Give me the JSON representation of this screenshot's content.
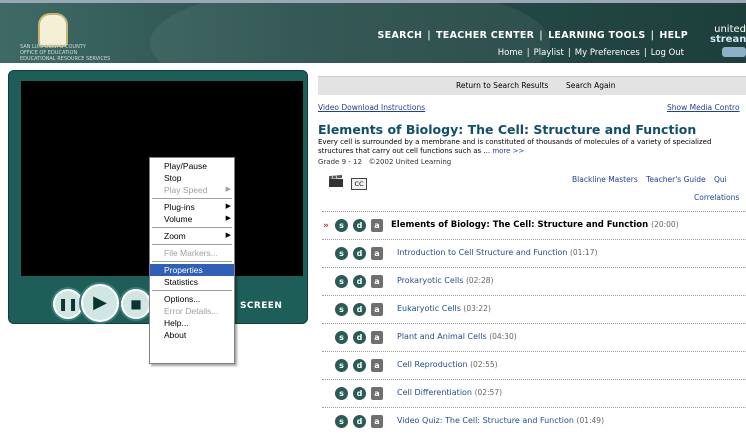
{
  "header": {
    "logo_lines": [
      "SAN LUIS OBISPO COUNTY",
      "OFFICE OF EDUCATION",
      "EDUCATIONAL RESOURCE SERVICES"
    ],
    "nav_main": [
      "SEARCH",
      "TEACHER CENTER",
      "LEARNING TOOLS",
      "HELP"
    ],
    "nav_sub": [
      "Home",
      "Playlist",
      "My Preferences",
      "Log Out"
    ],
    "brand": [
      "united",
      "strean"
    ]
  },
  "player": {
    "pause_icon": "pause-icon",
    "play_icon": "play-icon",
    "stop_icon": "stop-icon",
    "fullscreen_label": "SCREEN"
  },
  "context_menu": {
    "items": [
      {
        "label": "Play/Pause",
        "enabled": true,
        "submenu": false
      },
      {
        "label": "Stop",
        "enabled": true,
        "submenu": false
      },
      {
        "label": "Play Speed",
        "enabled": false,
        "submenu": true
      },
      {
        "label": "Plug-ins",
        "enabled": true,
        "submenu": true
      },
      {
        "label": "Volume",
        "enabled": true,
        "submenu": true
      },
      {
        "label": "Zoom",
        "enabled": true,
        "submenu": true
      },
      {
        "label": "File Markers...",
        "enabled": false,
        "submenu": false
      },
      {
        "label": "Properties",
        "enabled": true,
        "submenu": false,
        "selected": true
      },
      {
        "label": "Statistics",
        "enabled": true,
        "submenu": false
      },
      {
        "label": "Options...",
        "enabled": true,
        "submenu": false
      },
      {
        "label": "Error Details...",
        "enabled": false,
        "submenu": false
      },
      {
        "label": "Help...",
        "enabled": true,
        "submenu": false
      },
      {
        "label": "About",
        "enabled": true,
        "submenu": false
      }
    ]
  },
  "main": {
    "return_label": "Return to Search Results",
    "search_again_label": "Search Again",
    "download_link": "Video Download Instructions",
    "media_controls_link": "Show Media Contro",
    "title": "Elements of Biology: The Cell: Structure and Function",
    "description": "Every cell is surrounded by a membrane and is constituted of thousands of molecules of a variety of specialized structures that carry out cell functions such as ...",
    "more_link": "more >>",
    "grade": "Grade 9 - 12",
    "copyright": "©2002 United Learning",
    "cc_label": "CC",
    "resources": [
      "Blackline Masters",
      "Teacher's Guide",
      "Qui"
    ],
    "correlations_link": "Correlations",
    "current_marker": "»",
    "badge_labels": {
      "s": "s",
      "d": "d",
      "a": "a"
    },
    "segments": [
      {
        "title": "Elements of Biology: The Cell: Structure and Function",
        "duration": "(20:00)"
      },
      {
        "title": "Introduction to Cell Structure and Function",
        "duration": "(01:17)"
      },
      {
        "title": "Prokaryotic Cells",
        "duration": "(02:28)"
      },
      {
        "title": "Eukaryotic Cells",
        "duration": "(03:22)"
      },
      {
        "title": "Plant and Animal Cells",
        "duration": "(04:30)"
      },
      {
        "title": "Cell Reproduction",
        "duration": "(02:55)"
      },
      {
        "title": "Cell Differentiation",
        "duration": "(02:57)"
      },
      {
        "title": "Video Quiz: The Cell: Structure and Function",
        "duration": "(01:49)"
      }
    ]
  }
}
